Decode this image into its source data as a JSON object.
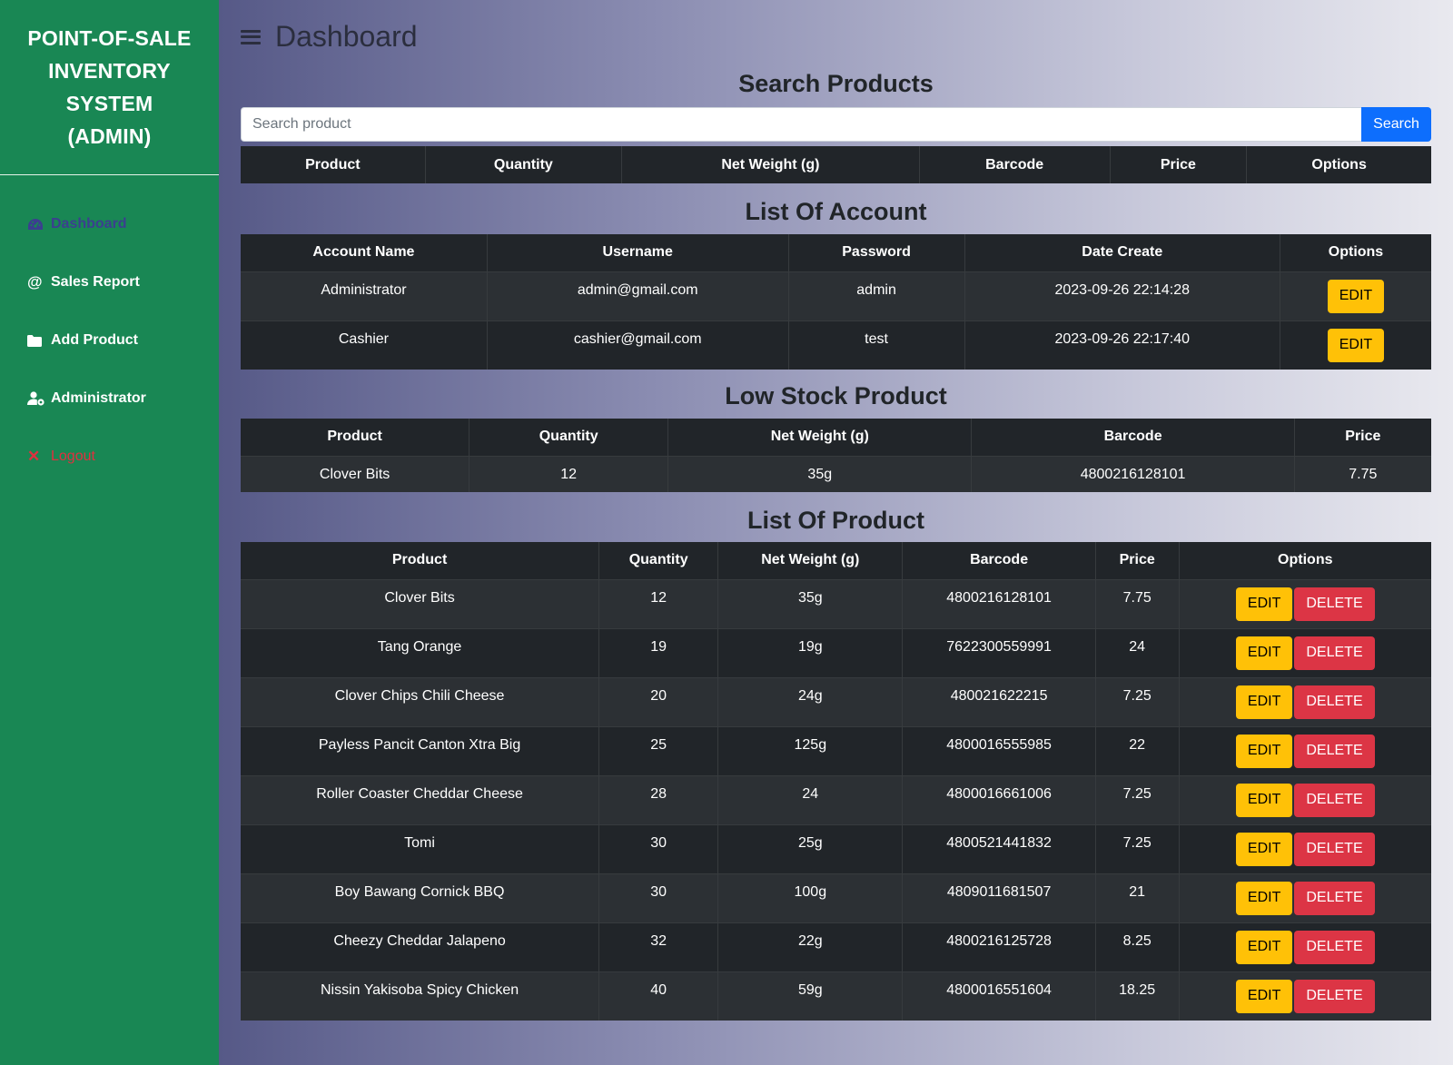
{
  "sidebar": {
    "brand_lines": [
      "POINT-OF-SALE",
      "INVENTORY",
      "SYSTEM",
      "(ADMIN)"
    ],
    "items": [
      {
        "label": "Dashboard",
        "icon": "gauge-icon"
      },
      {
        "label": "Sales Report",
        "icon": "at-icon"
      },
      {
        "label": "Add Product",
        "icon": "folder-icon"
      },
      {
        "label": "Administrator",
        "icon": "user-gear-icon"
      },
      {
        "label": "Logout",
        "icon": "close-icon"
      }
    ]
  },
  "header": {
    "title": "Dashboard"
  },
  "search": {
    "title": "Search Products",
    "placeholder": "Search product",
    "button": "Search",
    "columns": [
      "Product",
      "Quantity",
      "Net Weight (g)",
      "Barcode",
      "Price",
      "Options"
    ]
  },
  "accounts": {
    "title": "List Of Account",
    "columns": [
      "Account Name",
      "Username",
      "Password",
      "Date Create",
      "Options"
    ],
    "edit_label": "EDIT",
    "rows": [
      [
        "Administrator",
        "admin@gmail.com",
        "admin",
        "2023-09-26 22:14:28"
      ],
      [
        "Cashier",
        "cashier@gmail.com",
        "test",
        "2023-09-26 22:17:40"
      ]
    ]
  },
  "low_stock": {
    "title": "Low Stock Product",
    "columns": [
      "Product",
      "Quantity",
      "Net Weight (g)",
      "Barcode",
      "Price"
    ],
    "rows": [
      [
        "Clover Bits",
        "12",
        "35g",
        "4800216128101",
        "7.75"
      ]
    ]
  },
  "products": {
    "title": "List Of Product",
    "columns": [
      "Product",
      "Quantity",
      "Net Weight (g)",
      "Barcode",
      "Price",
      "Options"
    ],
    "edit_label": "EDIT",
    "delete_label": "DELETE",
    "rows": [
      [
        "Clover Bits",
        "12",
        "35g",
        "4800216128101",
        "7.75"
      ],
      [
        "Tang Orange",
        "19",
        "19g",
        "7622300559991",
        "24"
      ],
      [
        "Clover Chips Chili Cheese",
        "20",
        "24g",
        "480021622215",
        "7.25"
      ],
      [
        "Payless Pancit Canton Xtra Big",
        "25",
        "125g",
        "4800016555985",
        "22"
      ],
      [
        "Roller Coaster Cheddar Cheese",
        "28",
        "24",
        "4800016661006",
        "7.25"
      ],
      [
        "Tomi",
        "30",
        "25g",
        "4800521441832",
        "7.25"
      ],
      [
        "Boy Bawang Cornick BBQ",
        "30",
        "100g",
        "4809011681507",
        "21"
      ],
      [
        "Cheezy Cheddar Jalapeno",
        "32",
        "22g",
        "4800216125728",
        "8.25"
      ],
      [
        "Nissin Yakisoba Spicy Chicken",
        "40",
        "59g",
        "4800016551604",
        "18.25"
      ]
    ]
  },
  "colors": {
    "sidebar": "#198754",
    "edit": "#ffc107",
    "delete": "#dc3545",
    "search": "#0d6efd",
    "table_dark": "#212529"
  }
}
